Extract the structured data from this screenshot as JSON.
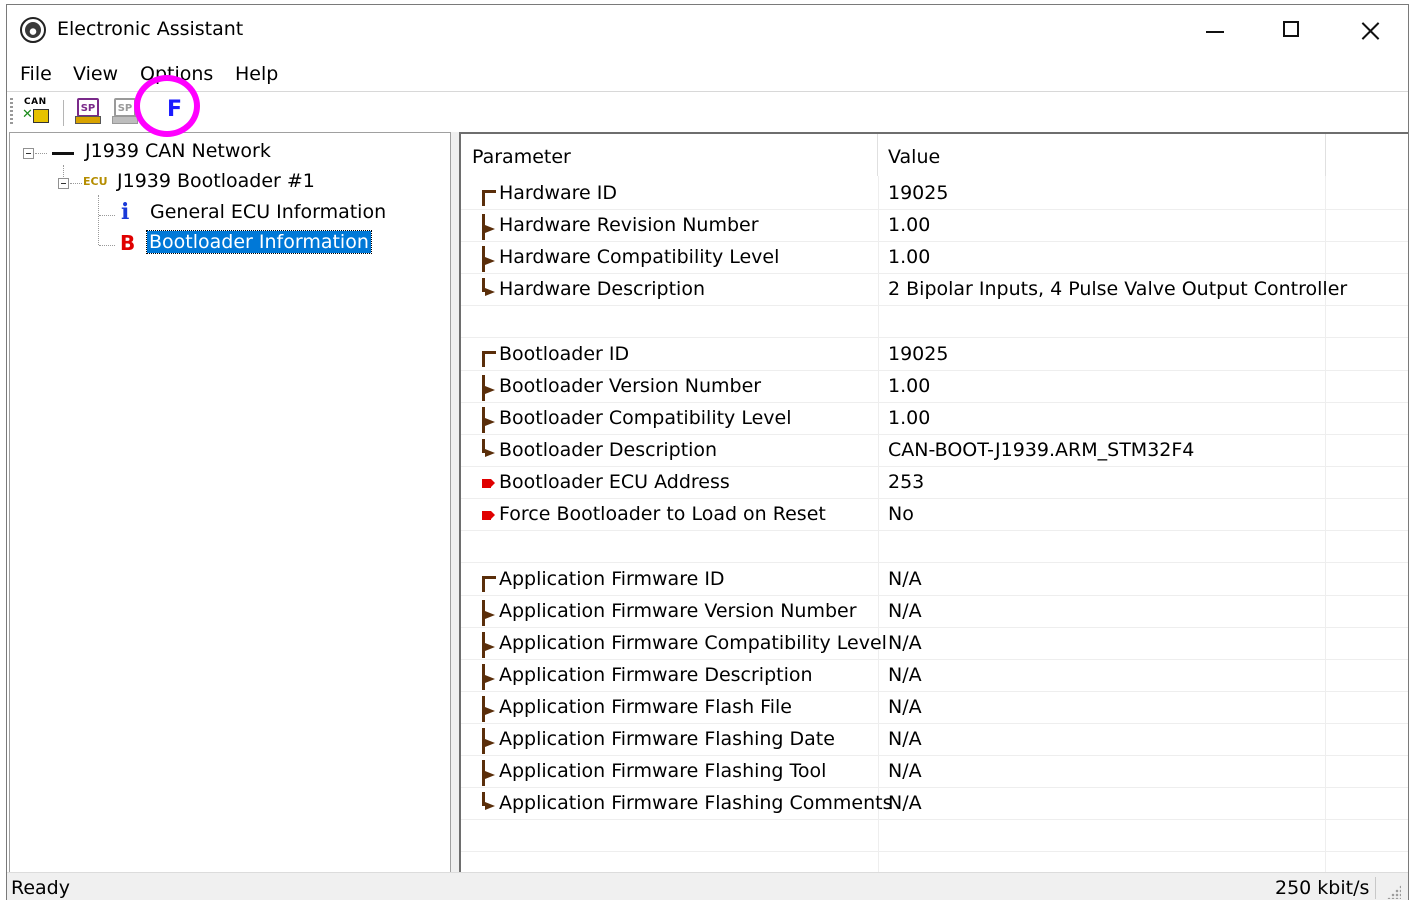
{
  "window": {
    "title": "Electronic Assistant"
  },
  "menu": [
    "File",
    "View",
    "Options",
    "Help"
  ],
  "toolbar": {
    "can_text": "CAN",
    "sp_text": "SP",
    "f_label": "F"
  },
  "tree": {
    "network": "J1939 CAN Network",
    "ecu_badge": "ECU",
    "ecu": "J1939 Bootloader #1",
    "info_icon": "i",
    "b_icon": "B",
    "children": [
      "General ECU Information",
      "Bootloader Information"
    ]
  },
  "table": {
    "headers": [
      "Parameter",
      "Value"
    ],
    "groups": [
      [
        {
          "param": "Hardware ID",
          "value": "19025"
        },
        {
          "param": "Hardware Revision Number",
          "value": "1.00"
        },
        {
          "param": "Hardware Compatibility Level",
          "value": "1.00"
        },
        {
          "param": "Hardware Description",
          "value": "2 Bipolar Inputs, 4 Pulse Valve Output Controller"
        }
      ],
      [
        {
          "param": "Bootloader ID",
          "value": "19025"
        },
        {
          "param": "Bootloader Version Number",
          "value": "1.00"
        },
        {
          "param": "Bootloader Compatibility Level",
          "value": "1.00"
        },
        {
          "param": "Bootloader Description",
          "value": "CAN-BOOT-J1939.ARM_STM32F4"
        },
        {
          "param": "Bootloader ECU Address",
          "value": "253"
        },
        {
          "param": "Force Bootloader to Load on Reset",
          "value": "No"
        }
      ],
      [
        {
          "param": "Application Firmware ID",
          "value": "N/A"
        },
        {
          "param": "Application Firmware Version Number",
          "value": "N/A"
        },
        {
          "param": "Application Firmware Compatibility Level",
          "value": "N/A"
        },
        {
          "param": "Application Firmware Description",
          "value": "N/A"
        },
        {
          "param": "Application Firmware Flash File",
          "value": "N/A"
        },
        {
          "param": "Application Firmware Flashing Date",
          "value": "N/A"
        },
        {
          "param": "Application Firmware Flashing Tool",
          "value": "N/A"
        },
        {
          "param": "Application Firmware Flashing Comments",
          "value": "N/A"
        }
      ]
    ]
  },
  "status": {
    "left": "Ready",
    "right": "250 kbit/s"
  },
  "colors": {
    "selection": "#0078d7",
    "highlight_ring": "#ff00ff",
    "f_button": "#1a1aff",
    "b_icon": "#e00000",
    "info_icon": "#1a3ad8"
  }
}
